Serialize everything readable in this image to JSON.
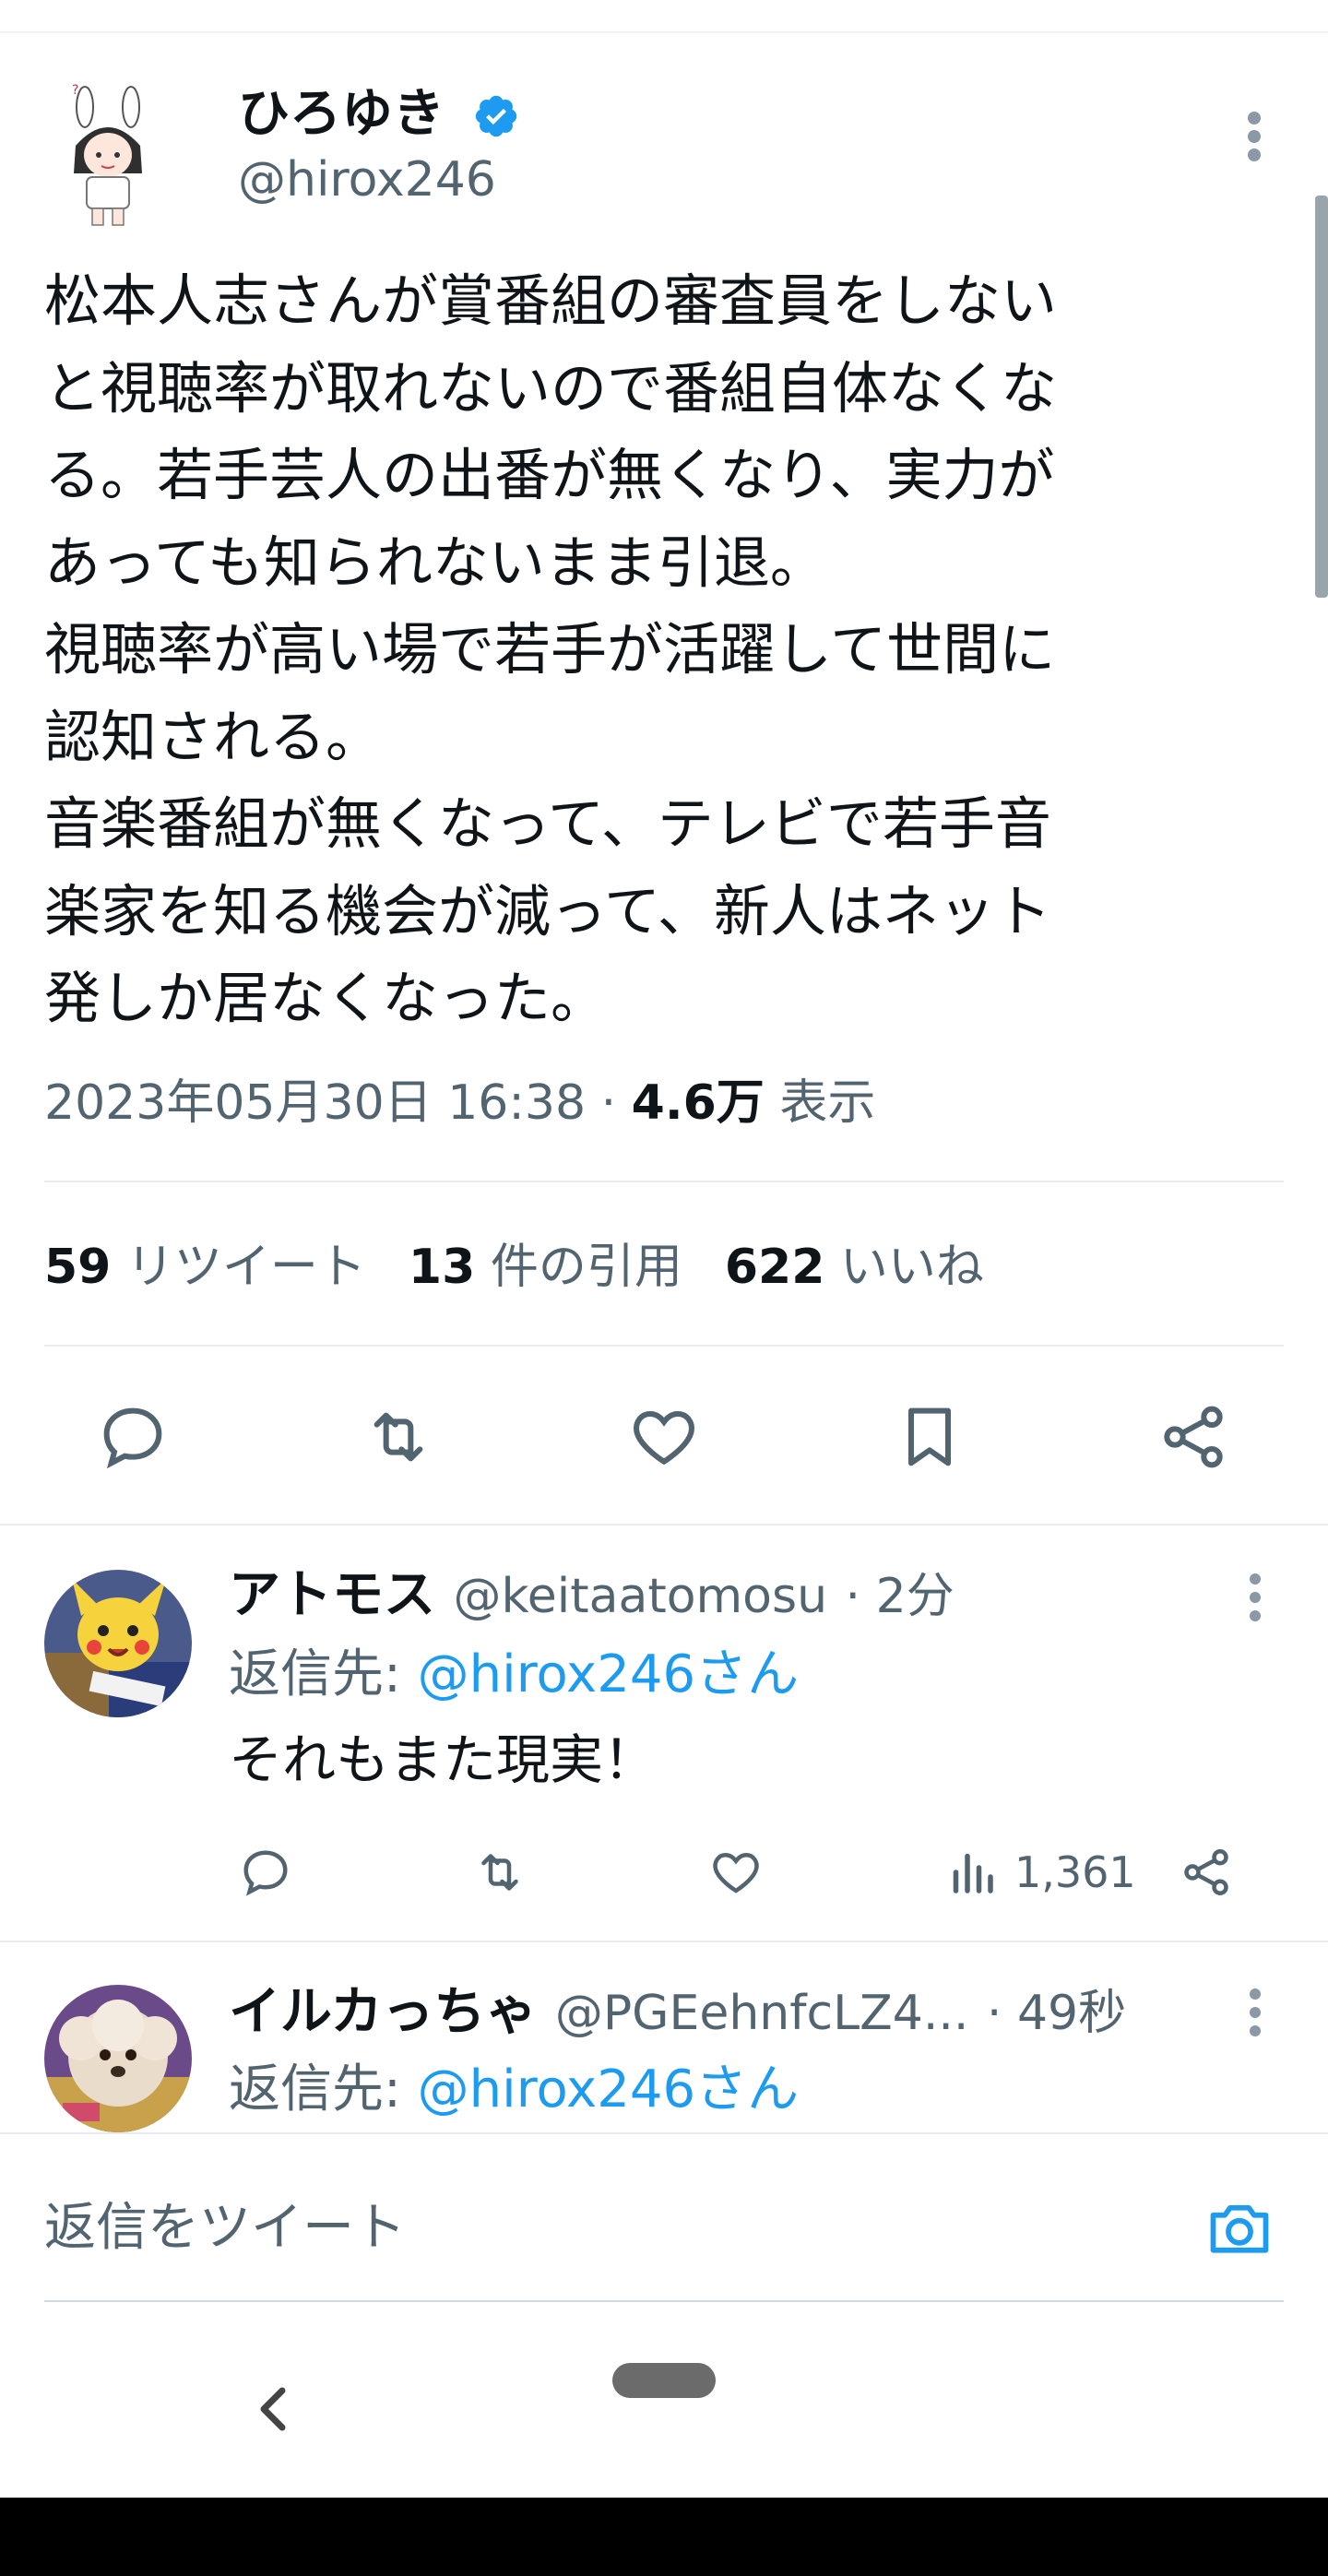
{
  "tweet": {
    "author_name": "ひろゆき",
    "author_handle": "@hirox246",
    "verified_icon": "verified-badge-icon",
    "body": "松本人志さんが賞番組の審査員をしない\nと視聴率が取れないので番組自体なくな\nる。若手芸人の出番が無くなり、実力が\nあっても知られないまま引退。\n視聴率が高い場で若手が活躍して世間に\n認知される。\n音楽番組が無くなって、テレビで若手音\n楽家を知る機会が減って、新人はネット\n発しか居なくなった。",
    "timestamp": "2023年05月30日 16:38",
    "separator": " · ",
    "views_count": "4.6万",
    "views_label": "表示",
    "retweets_count": "59",
    "retweets_label": "リツイート",
    "quotes_count": "13",
    "quotes_label": "件の引用",
    "likes_count": "622",
    "likes_label": "いいね"
  },
  "replies": [
    {
      "name": "アトモス",
      "handle": "@keitaatomosu",
      "time": "· 2分",
      "reply_to_label": "返信先: ",
      "reply_to_handle": "@hirox246さん",
      "text": "それもまた現実！",
      "views": "1,361"
    },
    {
      "name": "イルカっちゃ",
      "handle": "@PGEehnfcLZ4...",
      "time": "· 49秒",
      "reply_to_label": "返信先: ",
      "reply_to_handle": "@hirox246さん"
    }
  ],
  "composer": {
    "placeholder": "返信をツイート"
  },
  "colors": {
    "accent": "#1d9bf0",
    "secondary_text": "#536471",
    "divider": "#e6ecf0"
  }
}
